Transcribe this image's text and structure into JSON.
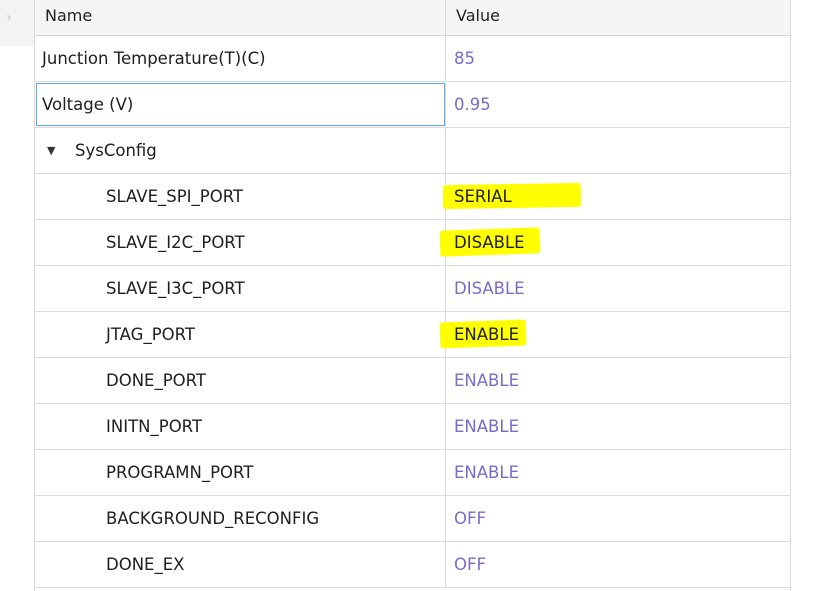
{
  "header": {
    "name_label": "Name",
    "value_label": "Value"
  },
  "icons": {
    "collapse": "chevron-right-icon",
    "expand": "triangle-down-icon"
  },
  "colors": {
    "default_value": "#7b6bc9",
    "edited_value": "#1e1e1e",
    "highlight": "#ffff00"
  },
  "rows": [
    {
      "name": "Junction Temperature(T)(C)",
      "value": "85"
    },
    {
      "name": "Voltage (V)",
      "value": "0.95",
      "selected": true
    },
    {
      "name": "SysConfig",
      "value": "",
      "group": true,
      "expanded": true
    },
    {
      "name": "SLAVE_SPI_PORT",
      "value": "SERIAL",
      "highlighted": true
    },
    {
      "name": "SLAVE_I2C_PORT",
      "value": "DISABLE",
      "highlighted": true
    },
    {
      "name": "SLAVE_I3C_PORT",
      "value": "DISABLE"
    },
    {
      "name": "JTAG_PORT",
      "value": "ENABLE",
      "highlighted": true
    },
    {
      "name": "DONE_PORT",
      "value": "ENABLE"
    },
    {
      "name": "INITN_PORT",
      "value": "ENABLE"
    },
    {
      "name": "PROGRAMN_PORT",
      "value": "ENABLE"
    },
    {
      "name": "BACKGROUND_RECONFIG",
      "value": "OFF"
    },
    {
      "name": "DONE_EX",
      "value": "OFF"
    }
  ]
}
